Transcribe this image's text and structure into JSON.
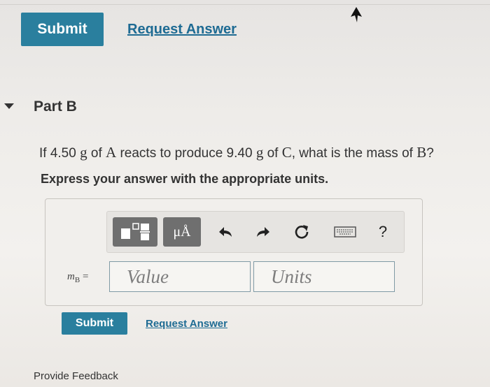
{
  "top_actions": {
    "submit_label": "Submit",
    "request_answer_label": "Request Answer"
  },
  "part": {
    "title": "Part B",
    "question": {
      "p1": "If 4.50 ",
      "u1": "g",
      "p2": " of ",
      "s1": "A",
      "p3": " reacts to produce 9.40 ",
      "u2": "g",
      "p4": " of ",
      "s2": "C",
      "p5": ", what is the mass of ",
      "s3": "B",
      "p6": "?"
    },
    "instruction": "Express your answer with the appropriate units."
  },
  "answer": {
    "toolbar": {
      "templates_icon": "fraction-template-icon",
      "units_symbol": "μÅ",
      "undo_icon": "undo-icon",
      "redo_icon": "redo-icon",
      "reset_icon": "reset-icon",
      "keyboard_icon": "keyboard-icon",
      "help_label": "?"
    },
    "variable_label": "m",
    "variable_sub": "B",
    "equals": "=",
    "value_placeholder": "Value",
    "units_placeholder": "Units"
  },
  "bottom_actions": {
    "submit_label": "Submit",
    "request_answer_label": "Request Answer"
  },
  "footer": {
    "feedback_label": "Provide Feedback"
  },
  "colors": {
    "accent": "#2a7f9e",
    "link": "#1e6b93"
  }
}
